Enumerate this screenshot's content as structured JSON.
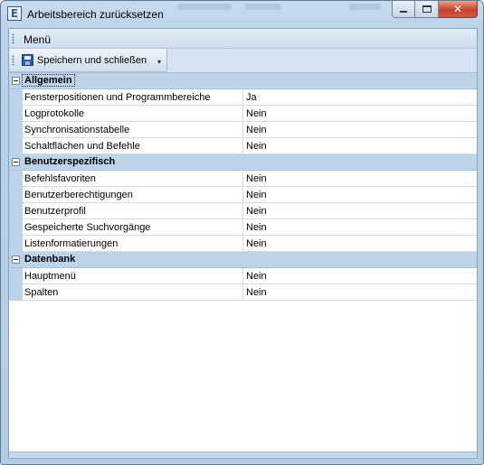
{
  "window": {
    "title": "Arbeitsbereich zurücksetzen",
    "app_icon_glyph": "E",
    "close_glyph": "✕",
    "accent_color": "#bcd3ea"
  },
  "menu": {
    "label": "Menü"
  },
  "toolbar": {
    "save_close_label": "Speichern und schließen",
    "dropdown_glyph": "▾"
  },
  "categories": [
    {
      "label": "Allgemein",
      "rows": [
        {
          "name": "Fensterpositionen und Programmbereiche",
          "value": "Ja"
        },
        {
          "name": "Logprotokolle",
          "value": "Nein"
        },
        {
          "name": "Synchronisationstabelle",
          "value": "Nein"
        },
        {
          "name": "Schaltflächen und Befehle",
          "value": "Nein"
        }
      ]
    },
    {
      "label": "Benutzerspezifisch",
      "rows": [
        {
          "name": "Befehlsfavoriten",
          "value": "Nein"
        },
        {
          "name": "Benutzerberechtigungen",
          "value": "Nein"
        },
        {
          "name": "Benutzerprofil",
          "value": "Nein"
        },
        {
          "name": "Gespeicherte Suchvorgänge",
          "value": "Nein"
        },
        {
          "name": "Listenformatierungen",
          "value": "Nein"
        }
      ]
    },
    {
      "label": "Datenbank",
      "rows": [
        {
          "name": "Hauptmenü",
          "value": "Nein"
        },
        {
          "name": "Spalten",
          "value": "Nein"
        }
      ]
    }
  ]
}
